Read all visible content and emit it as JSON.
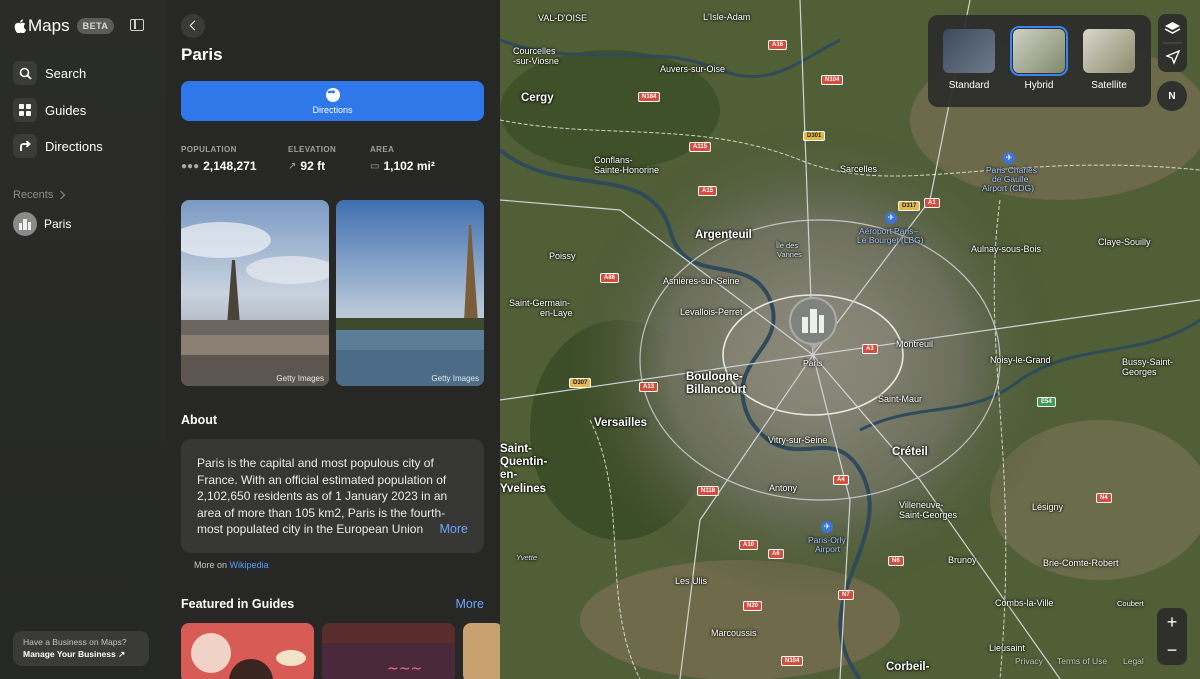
{
  "app": {
    "name": "Maps",
    "badge": "BETA"
  },
  "sidebar": {
    "items": [
      {
        "label": "Search",
        "icon": "magnifier-icon"
      },
      {
        "label": "Guides",
        "icon": "grid-icon"
      },
      {
        "label": "Directions",
        "icon": "turn-arrow-icon"
      }
    ],
    "recents_label": "Recents",
    "recents": [
      {
        "label": "Paris",
        "icon": "city-icon"
      }
    ],
    "business": {
      "question": "Have a Business on Maps?",
      "link": "Manage Your Business ↗"
    }
  },
  "place": {
    "title": "Paris",
    "directions_label": "Directions",
    "stats": [
      {
        "label": "POPULATION",
        "value": "2,148,271",
        "icon": "people-icon"
      },
      {
        "label": "ELEVATION",
        "value": "92 ft",
        "icon": "slope-arrow-icon"
      },
      {
        "label": "AREA",
        "value": "1,102 mi²",
        "icon": "square-outline-icon"
      }
    ],
    "photos": [
      {
        "credit": "Getty Images"
      },
      {
        "credit": "Getty Images"
      }
    ],
    "about_heading": "About",
    "about_text": "Paris is the capital and most populous city of France. With an official estimated population of 2,102,650 residents as of 1 January 2023 in an area of more than 105 km2, Paris is the fourth-most populated city in the European Union",
    "about_more": "More",
    "source_prefix": "More on",
    "source_link": "Wikipedia",
    "guides_heading": "Featured in Guides",
    "guides_more": "More"
  },
  "map": {
    "types": [
      {
        "label": "Standard",
        "selected": false
      },
      {
        "label": "Hybrid",
        "selected": true
      },
      {
        "label": "Satellite",
        "selected": false
      }
    ],
    "compass": "N",
    "pin_label": "Paris",
    "cities": {
      "cergy": "Cergy",
      "argenteuil": "Argenteuil",
      "boulogne1": "Boulogne-",
      "boulogne2": "Billancourt",
      "versailles": "Versailles",
      "creteil": "Créteil",
      "corbeil": "Corbeil-",
      "valdoise": "VAL-D'OISE",
      "lisle": "L'Isle-Adam",
      "courcelles1": "Courcelles",
      "courcelles2": "-sur-Viosne",
      "auvers": "Auvers-sur-Oise",
      "conflans1": "Conflans-",
      "conflans2": "Sainte-Honorine",
      "poissy": "Poissy",
      "sgl1": "Saint-Germain-",
      "sgl2": "en-Laye",
      "asnieres": "Asnières-sur-Seine",
      "levallois": "Levallois-Perret",
      "sarcelles": "Sarcelles",
      "aulnay": "Aulnay-sous-Bois",
      "claye": "Claye-Souilly",
      "montreuil": "Montreuil",
      "noisy": "Noisy-le-Grand",
      "bussy1": "Bussy-Saint-",
      "bussy2": "Georges",
      "saintmaur": "Saint-Maur",
      "vitry": "Vitry-sur-Seine",
      "antony": "Antony",
      "villeneuve1": "Villeneuve-",
      "villeneuve2": "Saint-Georges",
      "lesigny": "Lésigny",
      "brie": "Brie-Comte-Robert",
      "brunoy": "Brunoy",
      "combs": "Combs-la-Ville",
      "coubert": "Coubert",
      "lesulis": "Les Ulis",
      "marcoussis": "Marcoussis",
      "lieusaint": "Lieusaint",
      "yvette": "Yvette",
      "sq1": "Saint-",
      "sq2": "Quentin-",
      "sq3": "en-",
      "sq4": "Yvelines",
      "iledesvannes1": "Île des",
      "iledesvannes2": "Vannes"
    },
    "airports": {
      "cdg1": "Paris Charles",
      "cdg2": "de Gaulle",
      "cdg3": "Airport (CDG)",
      "lbg1": "Aéroport Paris–",
      "lbg2": "Le Bourget (LBG)",
      "orly1": "Paris-Orly",
      "orly2": "Airport"
    },
    "roads": [
      "A16",
      "N104",
      "N184",
      "D301",
      "A115",
      "A15",
      "D317",
      "A1",
      "A86",
      "A13",
      "D307",
      "A3",
      "N118",
      "A4",
      "A10",
      "A6",
      "N6",
      "E54",
      "N4",
      "N20",
      "N7",
      "N104"
    ],
    "legal": {
      "privacy": "Privacy",
      "terms": "Terms of Use",
      "legal": "Legal"
    }
  }
}
